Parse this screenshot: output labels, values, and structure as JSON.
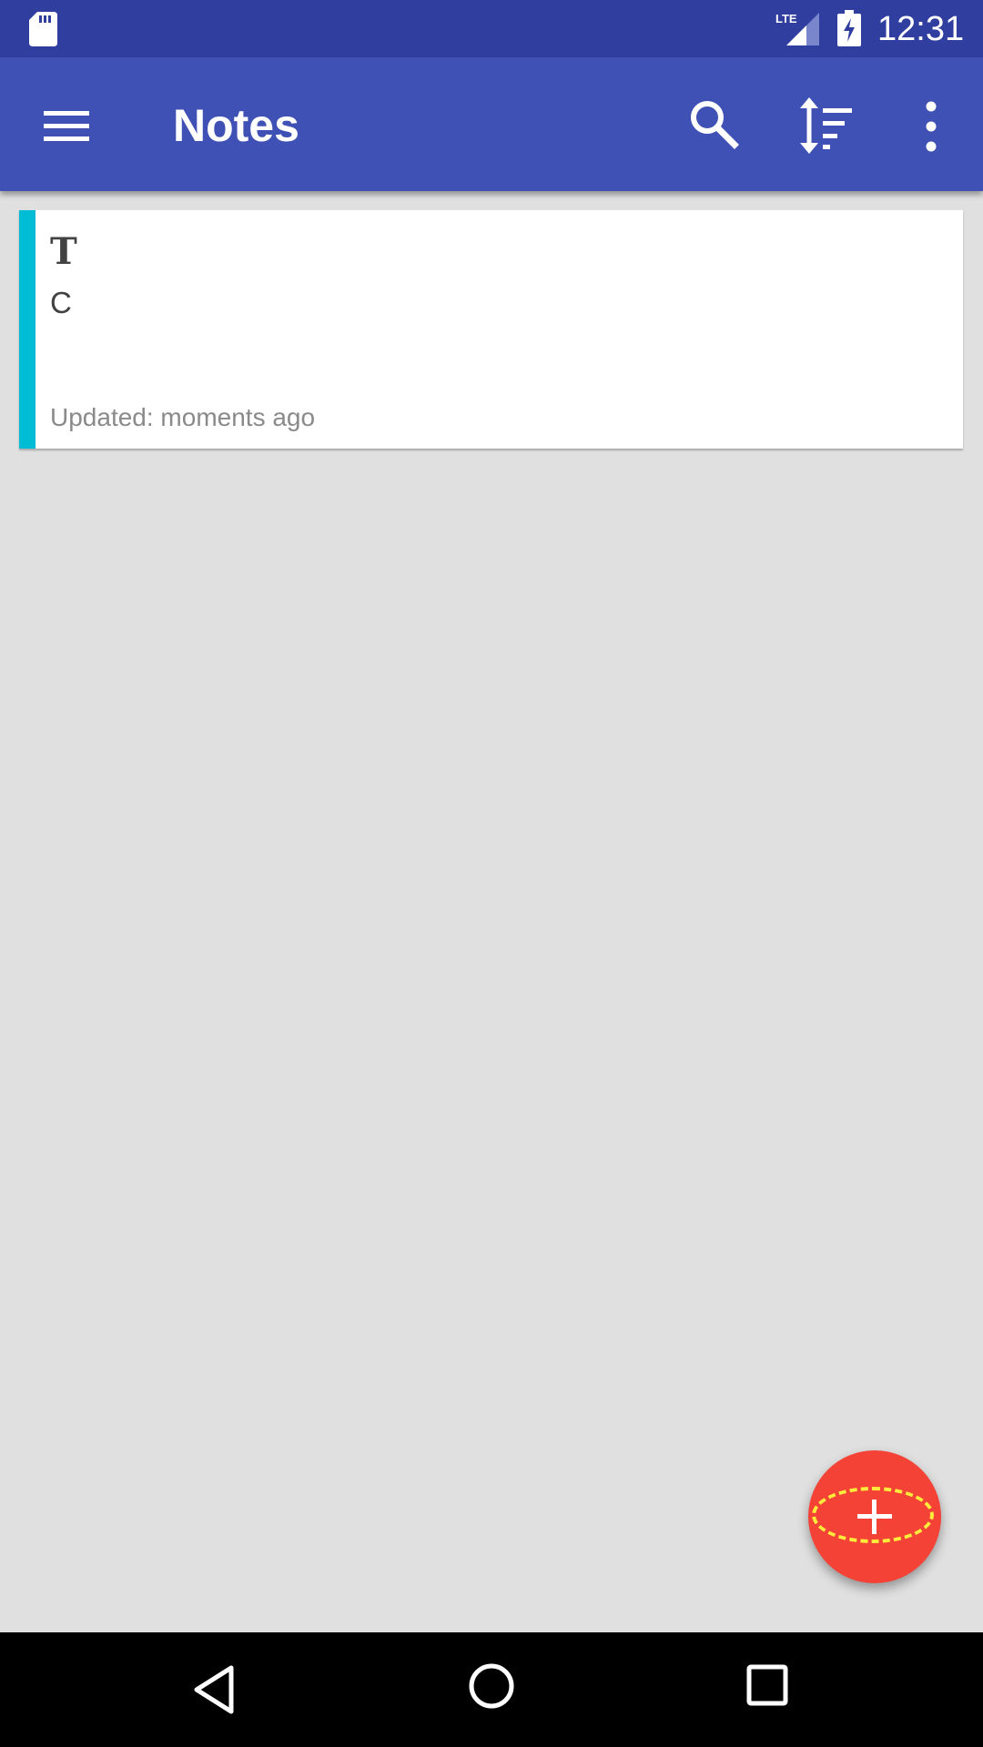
{
  "status_bar": {
    "time": "12:31",
    "network_label": "LTE",
    "icons": [
      "sd-card-icon",
      "lte-signal-icon",
      "battery-charging-icon"
    ]
  },
  "app_bar": {
    "title": "Notes",
    "actions": [
      "menu-icon",
      "search-icon",
      "sort-icon",
      "more-vert-icon"
    ]
  },
  "notes": [
    {
      "title": "T",
      "content": "C",
      "updated": "Updated: moments ago",
      "accent_color": "#00bcd4"
    }
  ],
  "fab": {
    "icon": "plus-icon",
    "color": "#f44336",
    "highlight_color": "#ffeb3b"
  },
  "nav_bar": {
    "icons": [
      "back-icon",
      "home-icon",
      "recents-icon"
    ]
  },
  "colors": {
    "status_bar": "#303f9f",
    "app_bar": "#3f51b5",
    "background": "#e0e0e0"
  }
}
